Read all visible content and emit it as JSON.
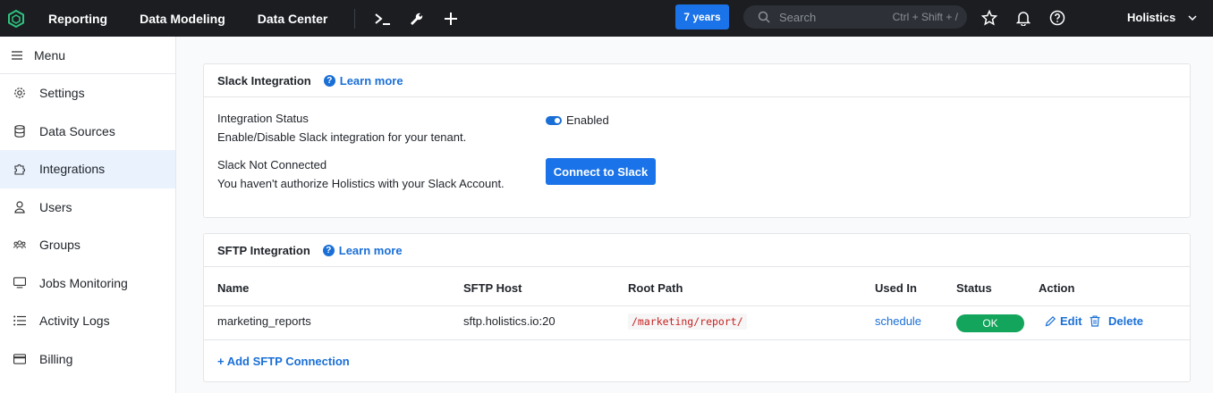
{
  "topbar": {
    "nav": [
      "Reporting",
      "Data Modeling",
      "Data Center"
    ],
    "years_badge": "7 years",
    "search_placeholder": "Search",
    "search_shortcut": "Ctrl + Shift + /",
    "tenant": "Holistics"
  },
  "sidebar": {
    "menu_label": "Menu",
    "items": [
      {
        "label": "Settings",
        "icon": "gear-icon"
      },
      {
        "label": "Data Sources",
        "icon": "database-icon"
      },
      {
        "label": "Integrations",
        "icon": "puzzle-icon",
        "active": true
      },
      {
        "label": "Users",
        "icon": "user-icon"
      },
      {
        "label": "Groups",
        "icon": "group-icon"
      },
      {
        "label": "Jobs Monitoring",
        "icon": "monitor-icon"
      },
      {
        "label": "Activity Logs",
        "icon": "list-icon"
      },
      {
        "label": "Billing",
        "icon": "credit-card-icon"
      }
    ]
  },
  "slack": {
    "title": "Slack Integration",
    "learn_more": "Learn more",
    "status_title": "Integration Status",
    "status_desc": "Enable/Disable Slack integration for your tenant.",
    "toggle_label": "Enabled",
    "conn_title": "Slack Not Connected",
    "conn_desc": "You haven't authorize Holistics with your Slack Account.",
    "connect_button": "Connect to Slack"
  },
  "sftp": {
    "title": "SFTP Integration",
    "learn_more": "Learn more",
    "headers": {
      "name": "Name",
      "host": "SFTP Host",
      "root": "Root Path",
      "used": "Used In",
      "status": "Status",
      "action": "Action"
    },
    "row": {
      "name": "marketing_reports",
      "host": "sftp.holistics.io:20",
      "root": "/marketing/report/",
      "used": "schedule",
      "status": "OK",
      "edit": "Edit",
      "delete": "Delete"
    },
    "add_link": "+ Add SFTP Connection"
  },
  "colors": {
    "accent": "#1a73e8",
    "ok": "#12a55b",
    "topbar": "#1b1d21"
  }
}
